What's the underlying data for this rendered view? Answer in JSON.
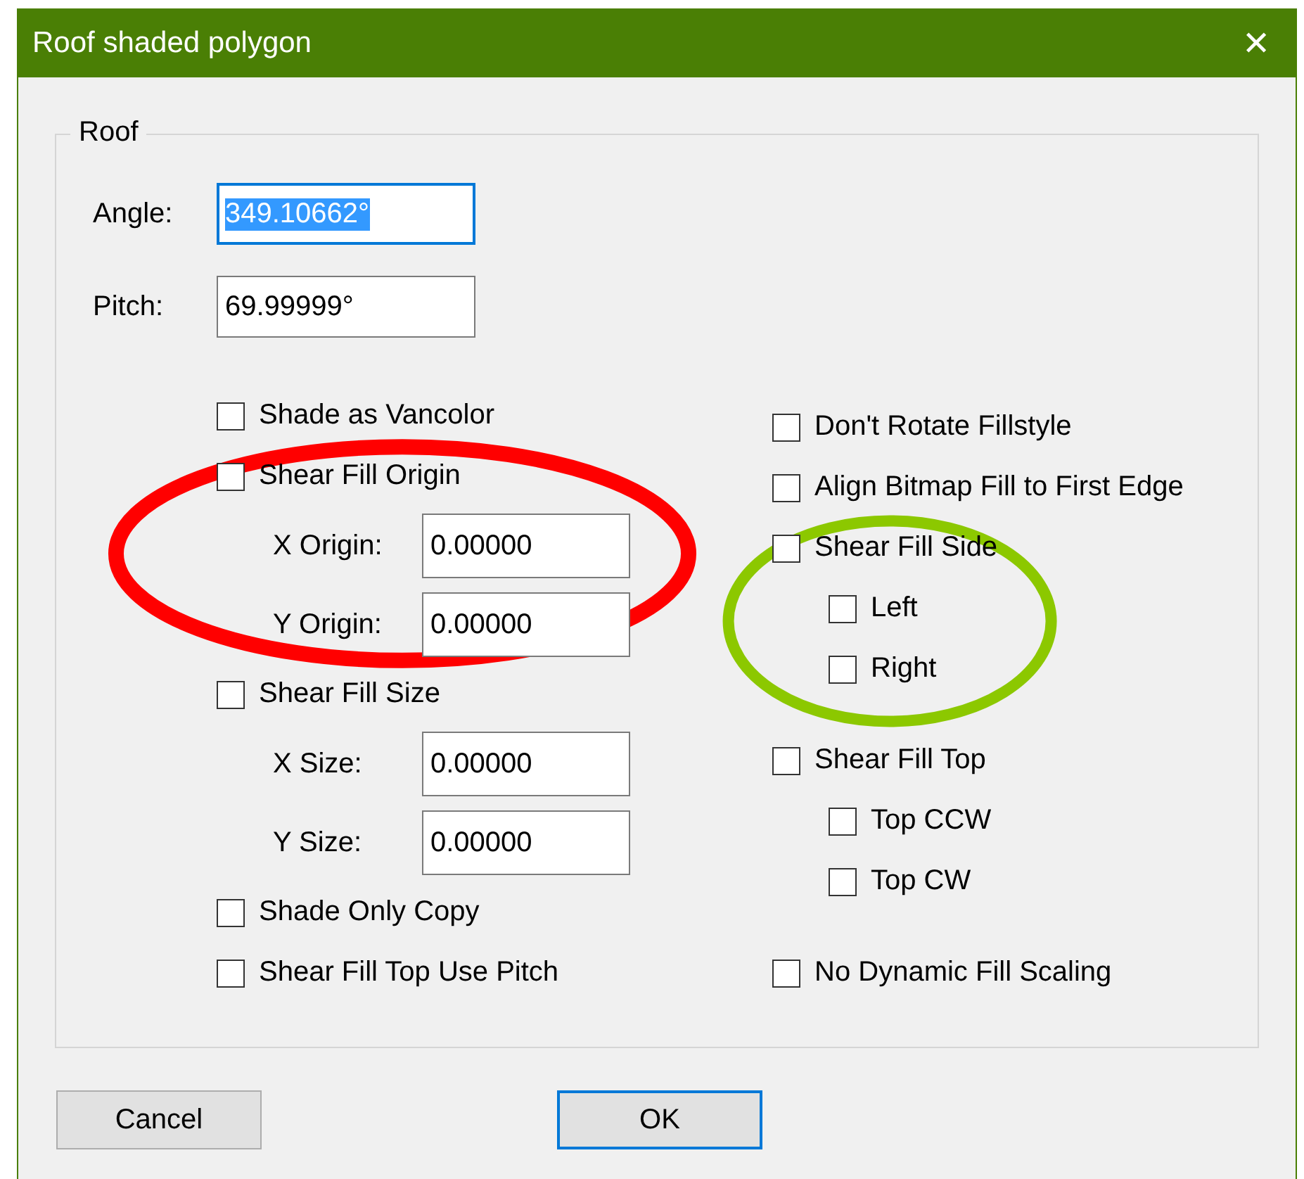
{
  "window": {
    "title": "Roof shaded polygon",
    "close": "✕"
  },
  "group": {
    "title": "Roof"
  },
  "top_fields": [
    {
      "label": "Angle:",
      "value": "349.10662°",
      "selected": true
    },
    {
      "label": "Pitch:",
      "value": "69.99999°",
      "selected": false
    }
  ],
  "left_items": [
    {
      "kind": "checkbox",
      "label": "Shade as Vancolor",
      "checked": false
    },
    {
      "kind": "checkbox",
      "label": "Shear Fill Origin",
      "checked": false,
      "color": "#ff0000",
      "children": [
        {
          "kind": "field",
          "label": "X Origin:",
          "value": "0.00000"
        },
        {
          "kind": "field",
          "label": "Y Origin:",
          "value": "0.00000"
        }
      ]
    },
    {
      "kind": "checkbox",
      "label": "Shear Fill Size",
      "checked": false,
      "children": [
        {
          "kind": "field",
          "label": "X Size:",
          "value": "0.00000"
        },
        {
          "kind": "field",
          "label": "Y Size:",
          "value": "0.00000"
        }
      ]
    },
    {
      "kind": "checkbox",
      "label": "Shade Only Copy",
      "checked": false
    },
    {
      "kind": "checkbox",
      "label": "Shear Fill Top Use Pitch",
      "checked": false
    }
  ],
  "right_items": [
    {
      "kind": "checkbox",
      "label": "Don't Rotate Fillstyle",
      "checked": false
    },
    {
      "kind": "checkbox",
      "label": "Align Bitmap Fill to First Edge",
      "checked": false
    },
    {
      "kind": "checkbox",
      "label": "Shear Fill Side",
      "checked": false,
      "color": "#8cc800",
      "children": [
        {
          "kind": "checkbox",
          "label": "Left",
          "checked": false
        },
        {
          "kind": "checkbox",
          "label": "Right",
          "checked": false
        }
      ]
    },
    {
      "kind": "checkbox",
      "label": "Shear Fill Top",
      "checked": false,
      "children": [
        {
          "kind": "checkbox",
          "label": "Top CCW",
          "checked": false
        },
        {
          "kind": "checkbox",
          "label": "Top CW",
          "checked": false
        }
      ]
    },
    {
      "kind": "checkbox",
      "label": "No Dynamic Fill Scaling",
      "checked": false
    }
  ],
  "buttons": [
    {
      "label": "Cancel",
      "default": false
    },
    {
      "label": "OK",
      "default": true
    }
  ]
}
